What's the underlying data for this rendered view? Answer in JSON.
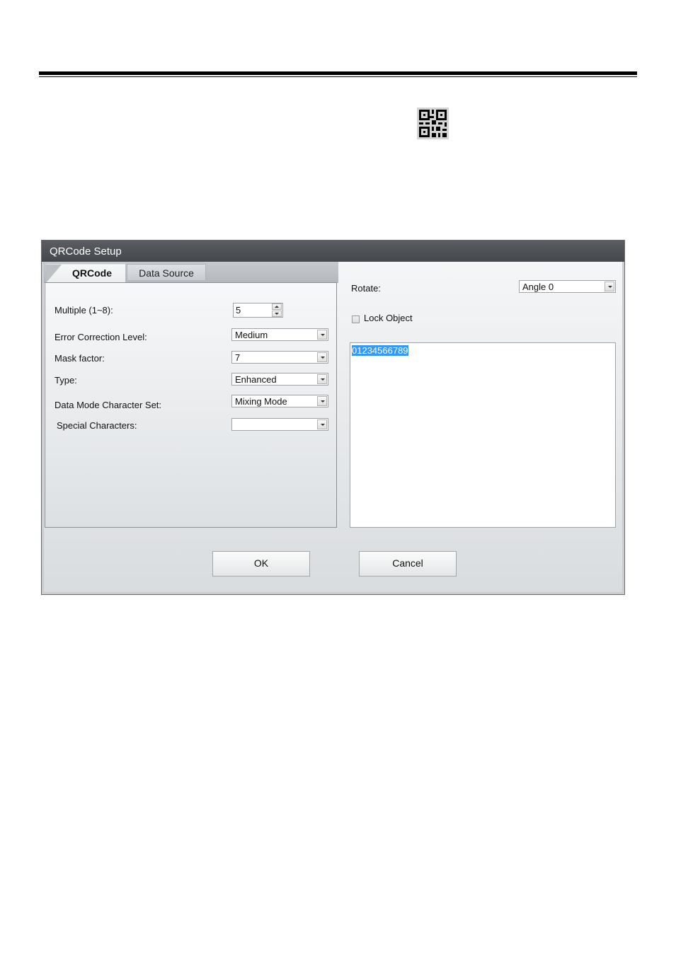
{
  "dialog": {
    "title": "QRCode Setup",
    "tabs": [
      {
        "label": "QRCode",
        "active": true
      },
      {
        "label": "Data Source",
        "active": false
      }
    ]
  },
  "qrcode_tab": {
    "multiple_label": "Multiple (1~8):",
    "multiple_value": "5",
    "error_level_label": "Error Correction Level:",
    "error_level_value": "Medium",
    "mask_label": "Mask factor:",
    "mask_value": "7",
    "type_label": "Type:",
    "type_value": "Enhanced",
    "charset_label": "Data Mode Character Set:",
    "charset_value": "Mixing Mode",
    "special_label": "Special Characters:",
    "special_value": ""
  },
  "right_panel": {
    "rotate_label": "Rotate:",
    "rotate_value": "Angle 0",
    "lock_label": "Lock Object",
    "lock_checked": false,
    "content_text": "01234566789"
  },
  "buttons": {
    "ok": "OK",
    "cancel": "Cancel"
  },
  "icons": {
    "toolbar_icon": "qr-code-icon"
  }
}
